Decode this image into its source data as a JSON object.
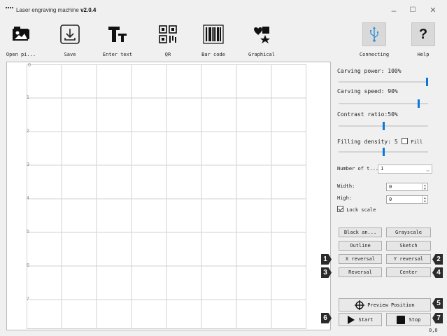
{
  "window": {
    "title_prefix": "Laser engraving machine",
    "version": "v2.0.4",
    "min_glyph": "–",
    "max_glyph": "☐",
    "close_glyph": "✕"
  },
  "toolbar": {
    "open_pictures": "Open pi...",
    "save": "Save",
    "enter_text": "Enter text",
    "qr": "QR",
    "bar_code": "Bar code",
    "graphical": "Graphical",
    "connecting": "Connecting",
    "help": "Help",
    "help_glyph": "?"
  },
  "canvas": {
    "row_labels": [
      "0",
      "1",
      "2",
      "3",
      "4",
      "5",
      "6",
      "7"
    ]
  },
  "settings": {
    "carving_power_label": "Carving power: 100%",
    "carving_power_value": 100,
    "carving_speed_label": "Carving speed: 90%",
    "carving_speed_value": 90,
    "contrast_ratio_label": "Contrast ratio:50%",
    "contrast_ratio_value": 50,
    "filling_density_label": "Filling density: 5",
    "filling_density_value": 5,
    "fill_label": "Fill",
    "number_of_times_label": "Number of t...",
    "number_of_times_value": "1",
    "width_label": "Width:",
    "width_value": "0",
    "high_label": "High:",
    "high_value": "0",
    "lock_scale_label": "Lock scale"
  },
  "actions": {
    "black_and_white": "Black an...",
    "grayscale": "Grayscale",
    "outline": "Outline",
    "sketch": "Sketch",
    "x_reversal": "X reversal",
    "y_reversal": "Y reversal",
    "reversal": "Reversal",
    "center": "Center",
    "preview_position": "Preview Position",
    "start": "Start",
    "stop": "Stop"
  },
  "badges": [
    "1",
    "2",
    "3",
    "4",
    "5",
    "6",
    "7"
  ],
  "status": {
    "readout": "0,0"
  },
  "colors": {
    "accent": "#0a78d7",
    "badge": "#2b2b2b"
  }
}
